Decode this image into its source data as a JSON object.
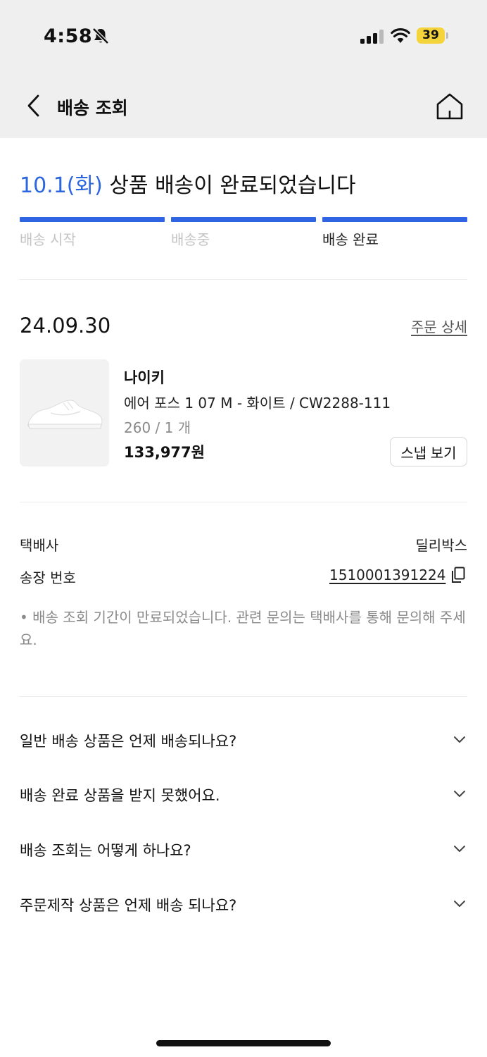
{
  "status_bar": {
    "time": "4:58",
    "battery": "39"
  },
  "nav": {
    "title": "배송 조회"
  },
  "headline": {
    "date": "10.1(화)",
    "text": " 상품 배송이 완료되었습니다"
  },
  "steps": [
    {
      "label": "배송 시작",
      "state": "done"
    },
    {
      "label": "배송중",
      "state": "done"
    },
    {
      "label": "배송 완료",
      "state": "current"
    }
  ],
  "order": {
    "date": "24.09.30",
    "detail_link": "주문 상세",
    "product": {
      "brand": "나이키",
      "name": "에어 포스 1 07 M - 화이트 / CW2288-111",
      "option": "260 / 1 개",
      "price": "133,977원",
      "snap_button": "스냅 보기"
    }
  },
  "shipping": {
    "carrier_label": "택배사",
    "carrier_value": "딜리박스",
    "tracking_label": "송장 번호",
    "tracking_value": "1510001391224",
    "notice": "• 배송 조회 기간이 만료되었습니다. 관련 문의는 택배사를 통해 문의해 주세요."
  },
  "faq": [
    "일반 배송 상품은 언제 배송되나요?",
    "배송 완료 상품을 받지 못했어요.",
    "배송 조회는 어떻게 하나요?",
    "주문제작 상품은 언제 배송 되나요?"
  ],
  "colors": {
    "accent": "#2f64e3",
    "top_bg": "#efefef",
    "battery": "#f5d33b"
  }
}
